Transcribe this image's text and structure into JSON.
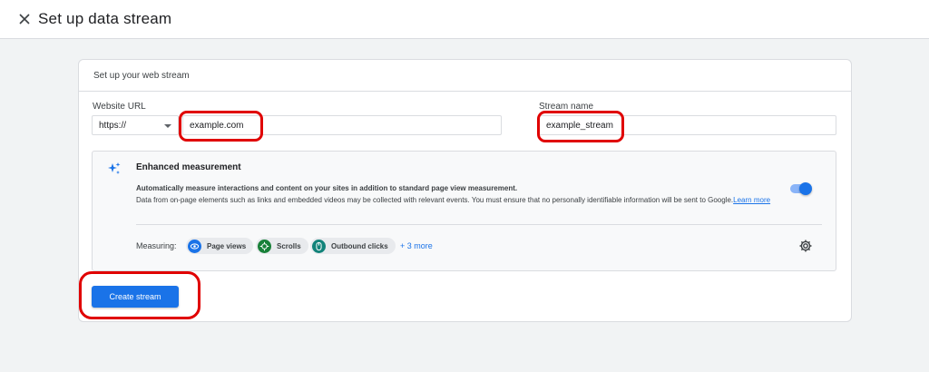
{
  "header": {
    "title": "Set up data stream",
    "close_icon": "close-icon"
  },
  "card": {
    "header": "Set up your web stream",
    "website_url": {
      "label": "Website URL",
      "protocol": "https://",
      "value": "example.com"
    },
    "stream_name": {
      "label": "Stream name",
      "value": "example_stream"
    },
    "enhanced_measurement": {
      "title": "Enhanced measurement",
      "description_bold": "Automatically measure interactions and content on your sites in addition to standard page view measurement.",
      "description": "Data from on-page elements such as links and embedded videos may be collected with relevant events. You must ensure that no personally identifiable information will be sent to Google.",
      "learn_more": "Learn more",
      "enabled": true,
      "measuring_label": "Measuring:",
      "chips": [
        {
          "label": "Page views",
          "icon": "eye-icon",
          "color": "#1a73e8"
        },
        {
          "label": "Scrolls",
          "icon": "crosshair-icon",
          "color": "#188038"
        },
        {
          "label": "Outbound clicks",
          "icon": "mouse-icon",
          "color": "#12837a"
        }
      ],
      "more": "+ 3 more"
    },
    "create_button": "Create stream"
  },
  "colors": {
    "accent": "#1a73e8",
    "highlight": "#e00000",
    "background": "#f1f3f4"
  }
}
